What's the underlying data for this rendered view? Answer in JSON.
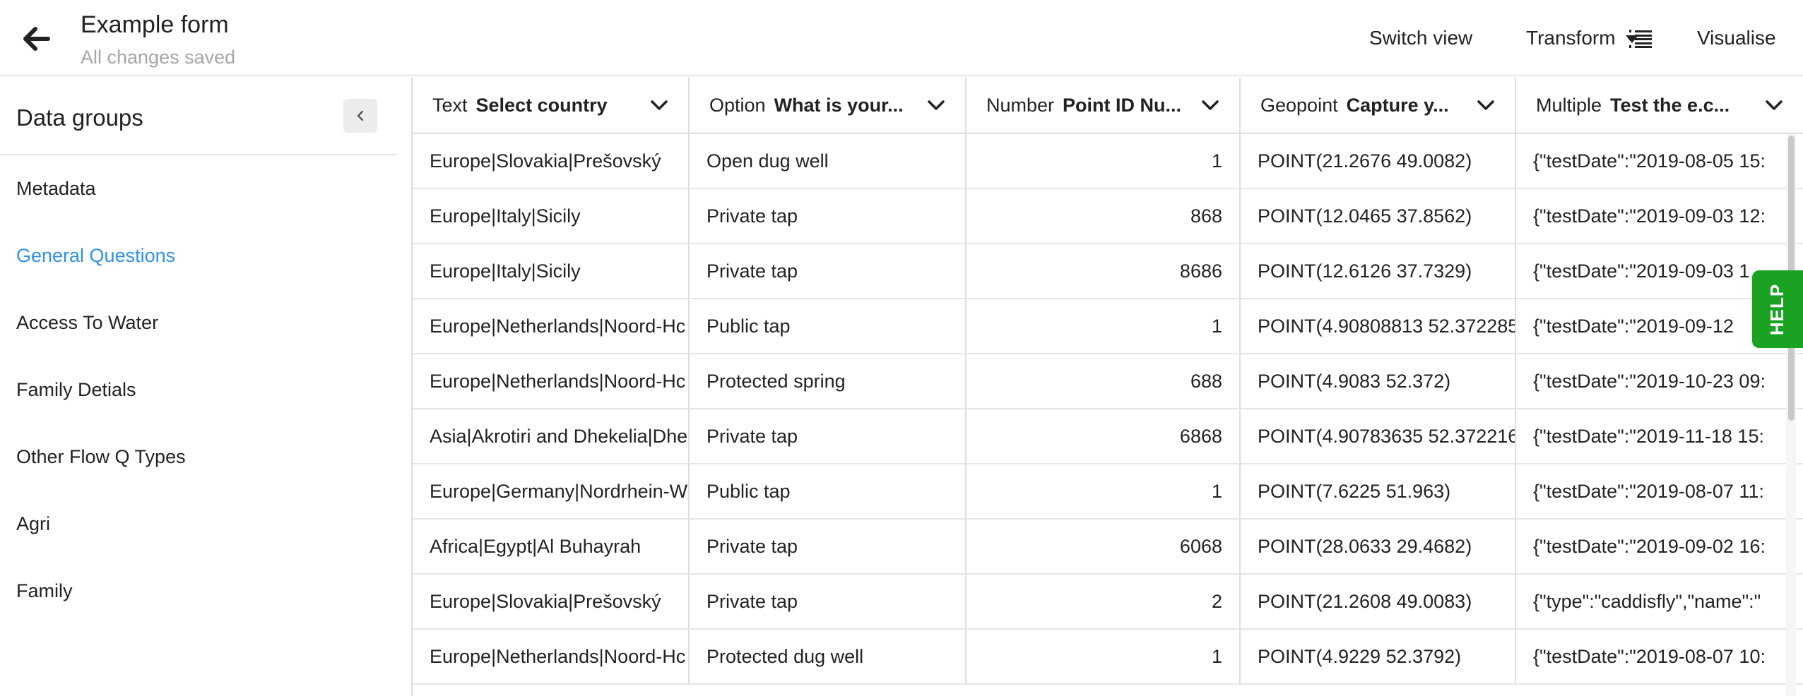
{
  "header": {
    "title": "Example form",
    "subtitle": "All changes saved",
    "switch_view": "Switch view",
    "transform": "Transform",
    "visualise": "Visualise"
  },
  "sidebar": {
    "title": "Data groups",
    "items": [
      {
        "label": "Metadata",
        "active": false
      },
      {
        "label": "General Questions",
        "active": true
      },
      {
        "label": "Access To Water",
        "active": false
      },
      {
        "label": "Family Detials",
        "active": false
      },
      {
        "label": "Other Flow Q Types",
        "active": false
      },
      {
        "label": "Agri",
        "active": false
      },
      {
        "label": "Family",
        "active": false
      }
    ]
  },
  "table": {
    "columns": [
      {
        "type": "Text",
        "name": "Select country"
      },
      {
        "type": "Option",
        "name": "What is your..."
      },
      {
        "type": "Number",
        "name": "Point ID Nu..."
      },
      {
        "type": "Geopoint",
        "name": "Capture y..."
      },
      {
        "type": "Multiple",
        "name": "Test the e.c..."
      }
    ],
    "rows": [
      [
        "Europe|Slovakia|Prešovský",
        "Open dug well",
        "1",
        "POINT(21.2676 49.0082)",
        "{\"testDate\":\"2019-08-05 15:"
      ],
      [
        "Europe|Italy|Sicily",
        "Private tap",
        "868",
        "POINT(12.0465 37.8562)",
        "{\"testDate\":\"2019-09-03 12:"
      ],
      [
        "Europe|Italy|Sicily",
        "Private tap",
        "8686",
        "POINT(12.6126 37.7329)",
        "{\"testDate\":\"2019-09-03 1"
      ],
      [
        "Europe|Netherlands|Noord-Hc",
        "Public tap",
        "1",
        "POINT(4.90808813 52.372285",
        "{\"testDate\":\"2019-09-12"
      ],
      [
        "Europe|Netherlands|Noord-Hc",
        "Protected spring",
        "688",
        "POINT(4.9083 52.372)",
        "{\"testDate\":\"2019-10-23 09:"
      ],
      [
        "Asia|Akrotiri and Dhekelia|Dhe",
        "Private tap",
        "6868",
        "POINT(4.90783635 52.372216",
        "{\"testDate\":\"2019-11-18 15:"
      ],
      [
        "Europe|Germany|Nordrhein-W",
        "Public tap",
        "1",
        "POINT(7.6225 51.963)",
        "{\"testDate\":\"2019-08-07 11:"
      ],
      [
        "Africa|Egypt|Al Buhayrah",
        "Private tap",
        "6068",
        "POINT(28.0633 29.4682)",
        "{\"testDate\":\"2019-09-02 16:"
      ],
      [
        "Europe|Slovakia|Prešovský",
        "Private tap",
        "2",
        "POINT(21.2608 49.0083)",
        "{\"type\":\"caddisfly\",\"name\":\""
      ],
      [
        "Europe|Netherlands|Noord-Hc",
        "Protected dug well",
        "1",
        "POINT(4.9229 52.3792)",
        "{\"testDate\":\"2019-08-07 10:"
      ]
    ]
  },
  "help": "HELP",
  "colors": {
    "accent": "#2f8ff0",
    "help_bg": "#1aa223",
    "subtitle": "#a6a6a6",
    "grid": "#dddddd"
  },
  "icons": [
    "back-arrow-icon",
    "caret-down-icon",
    "list-numbered-icon",
    "chevron-left-icon",
    "chevron-down-icon"
  ]
}
